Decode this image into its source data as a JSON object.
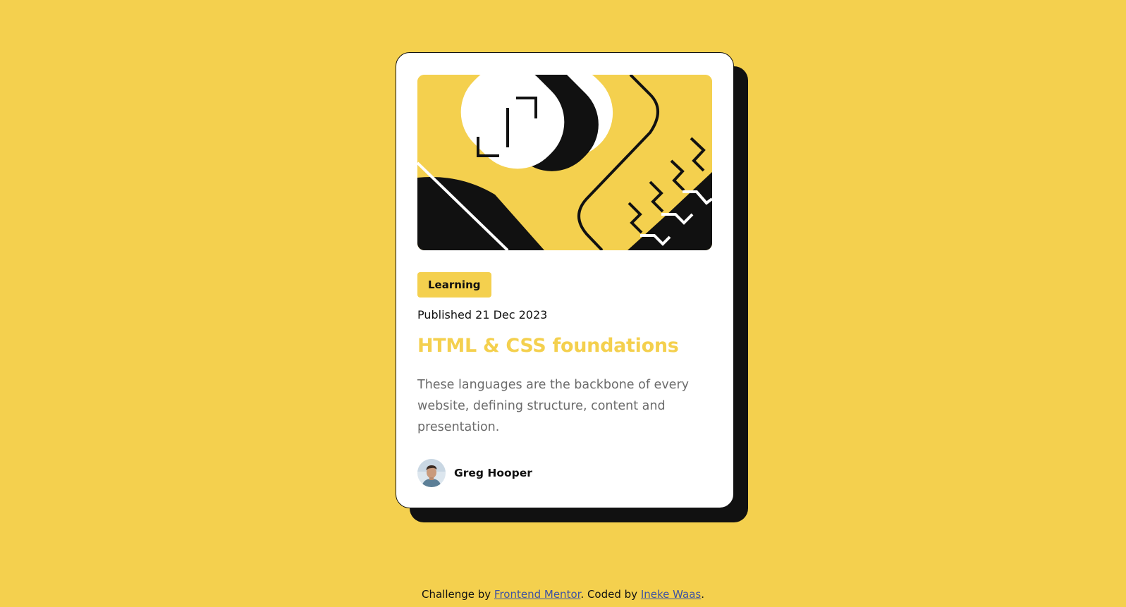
{
  "card": {
    "tag": "Learning",
    "published": "Published 21 Dec 2023",
    "title": "HTML & CSS foundations",
    "description": "These languages are the backbone of every website, defining structure, content and presentation.",
    "author": {
      "name": "Greg Hooper",
      "avatar_icon": "person-avatar-icon"
    },
    "illustration_icon": "code-illustration-icon"
  },
  "footer": {
    "prefix": "Challenge by ",
    "link1": "Frontend Mentor",
    "middle": ". Coded by ",
    "link2": "Ineke Waas",
    "suffix": "."
  },
  "colors": {
    "background": "#F4D04E",
    "ink": "#111111",
    "card": "#FFFFFF",
    "muted_text": "#6B6B6B",
    "link": "#3E52A3"
  }
}
